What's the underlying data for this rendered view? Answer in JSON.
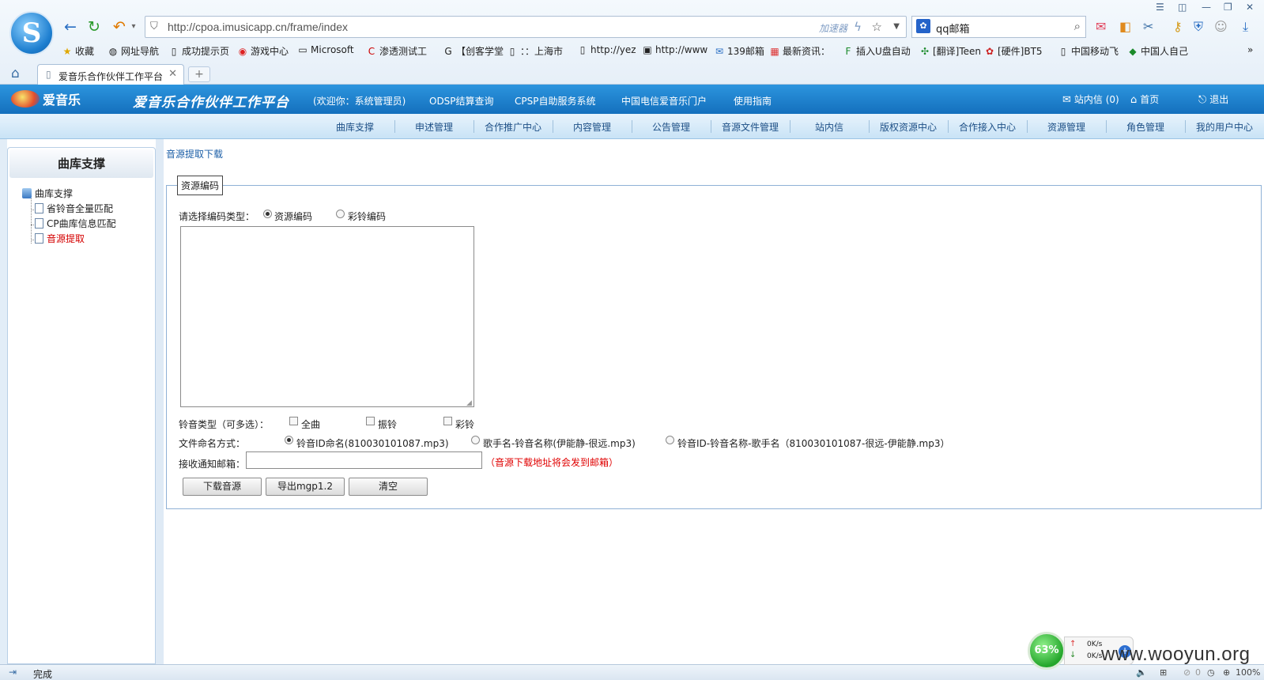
{
  "browser": {
    "url": "http://cpoa.imusicapp.cn/frame/index",
    "accelerator_label": "加速器",
    "search_value": "qq邮箱",
    "tab_title": "爱音乐合作伙伴工作平台",
    "bookmarks": [
      {
        "label": "收藏",
        "icon": "star-icon"
      },
      {
        "label": "网址导航",
        "icon": "globe-icon"
      },
      {
        "label": "成功提示页",
        "icon": "page-icon"
      },
      {
        "label": "游戏中心",
        "icon": "game-icon"
      },
      {
        "label": "Microsoft",
        "icon": "folder-icon"
      },
      {
        "label": "渗透测试工",
        "icon": "c-icon"
      },
      {
        "label": "【创客学堂",
        "icon": "g-icon"
      },
      {
        "label": "：：上海市",
        "icon": "page-icon"
      },
      {
        "label": "http://yez",
        "icon": "page-icon"
      },
      {
        "label": "http://www",
        "icon": "image-icon"
      },
      {
        "label": "139邮箱",
        "icon": "mail139-icon"
      },
      {
        "label": "最新资讯：",
        "icon": "news-icon"
      },
      {
        "label": "插入U盘自动",
        "icon": "f-icon"
      },
      {
        "label": "[翻译]Teen",
        "icon": "leaf-icon"
      },
      {
        "label": "[硬件]BT5",
        "icon": "paw-icon"
      },
      {
        "label": "中国移动飞",
        "icon": "page-icon"
      },
      {
        "label": "中国人自己",
        "icon": "flag-icon"
      }
    ],
    "status_text": "完成",
    "zoom": "100%",
    "status_count": "0",
    "speed": {
      "percent": "63%",
      "up": "0K/s",
      "down": "0K/s"
    }
  },
  "site": {
    "logo_text": "爱音乐",
    "title": "爱音乐合作伙伴工作平台",
    "header_links": [
      "(欢迎你：系统管理员)",
      "ODSP结算查询",
      "CPSP自助服务系统",
      "中国电信爱音乐门户",
      "使用指南"
    ],
    "header_right": {
      "messages": "站内信 (0)",
      "home": "首页",
      "logout": "退出"
    },
    "menu": [
      "曲库支撑",
      "申述管理",
      "合作推广中心",
      "内容管理",
      "公告管理",
      "音源文件管理",
      "站内信",
      "版权资源中心",
      "合作接入中心",
      "资源管理",
      "角色管理",
      "我的用户中心"
    ]
  },
  "sidebar": {
    "heading": "曲库支撑",
    "root": "曲库支撑",
    "items": [
      "省铃音全量匹配",
      "CP曲库信息匹配",
      "音源提取"
    ]
  },
  "main": {
    "breadcrumb": "音源提取下载",
    "legend": "资源编码",
    "code_type_label": "请选择编码类型：",
    "code_types": [
      "资源编码",
      "彩铃编码"
    ],
    "code_type_selected": "资源编码",
    "ring_type_label": "铃音类型（可多选）：",
    "ring_types": [
      "全曲",
      "振铃",
      "彩铃"
    ],
    "naming_label": "文件命名方式：",
    "naming_options": [
      "铃音ID命名(810030101087.mp3)",
      "歌手名-铃音名称(伊能静-很远.mp3)",
      "铃音ID-铃音名称-歌手名（810030101087-很远-伊能静.mp3）"
    ],
    "naming_selected": "铃音ID命名(810030101087.mp3)",
    "email_label": "接收通知邮箱：",
    "email_value": "",
    "email_hint": "（音源下载地址将会发到邮箱）",
    "buttons": {
      "download": "下载音源",
      "export": "导出mgp1.2",
      "clear": "清空"
    }
  },
  "watermark": "www.wooyun.org"
}
